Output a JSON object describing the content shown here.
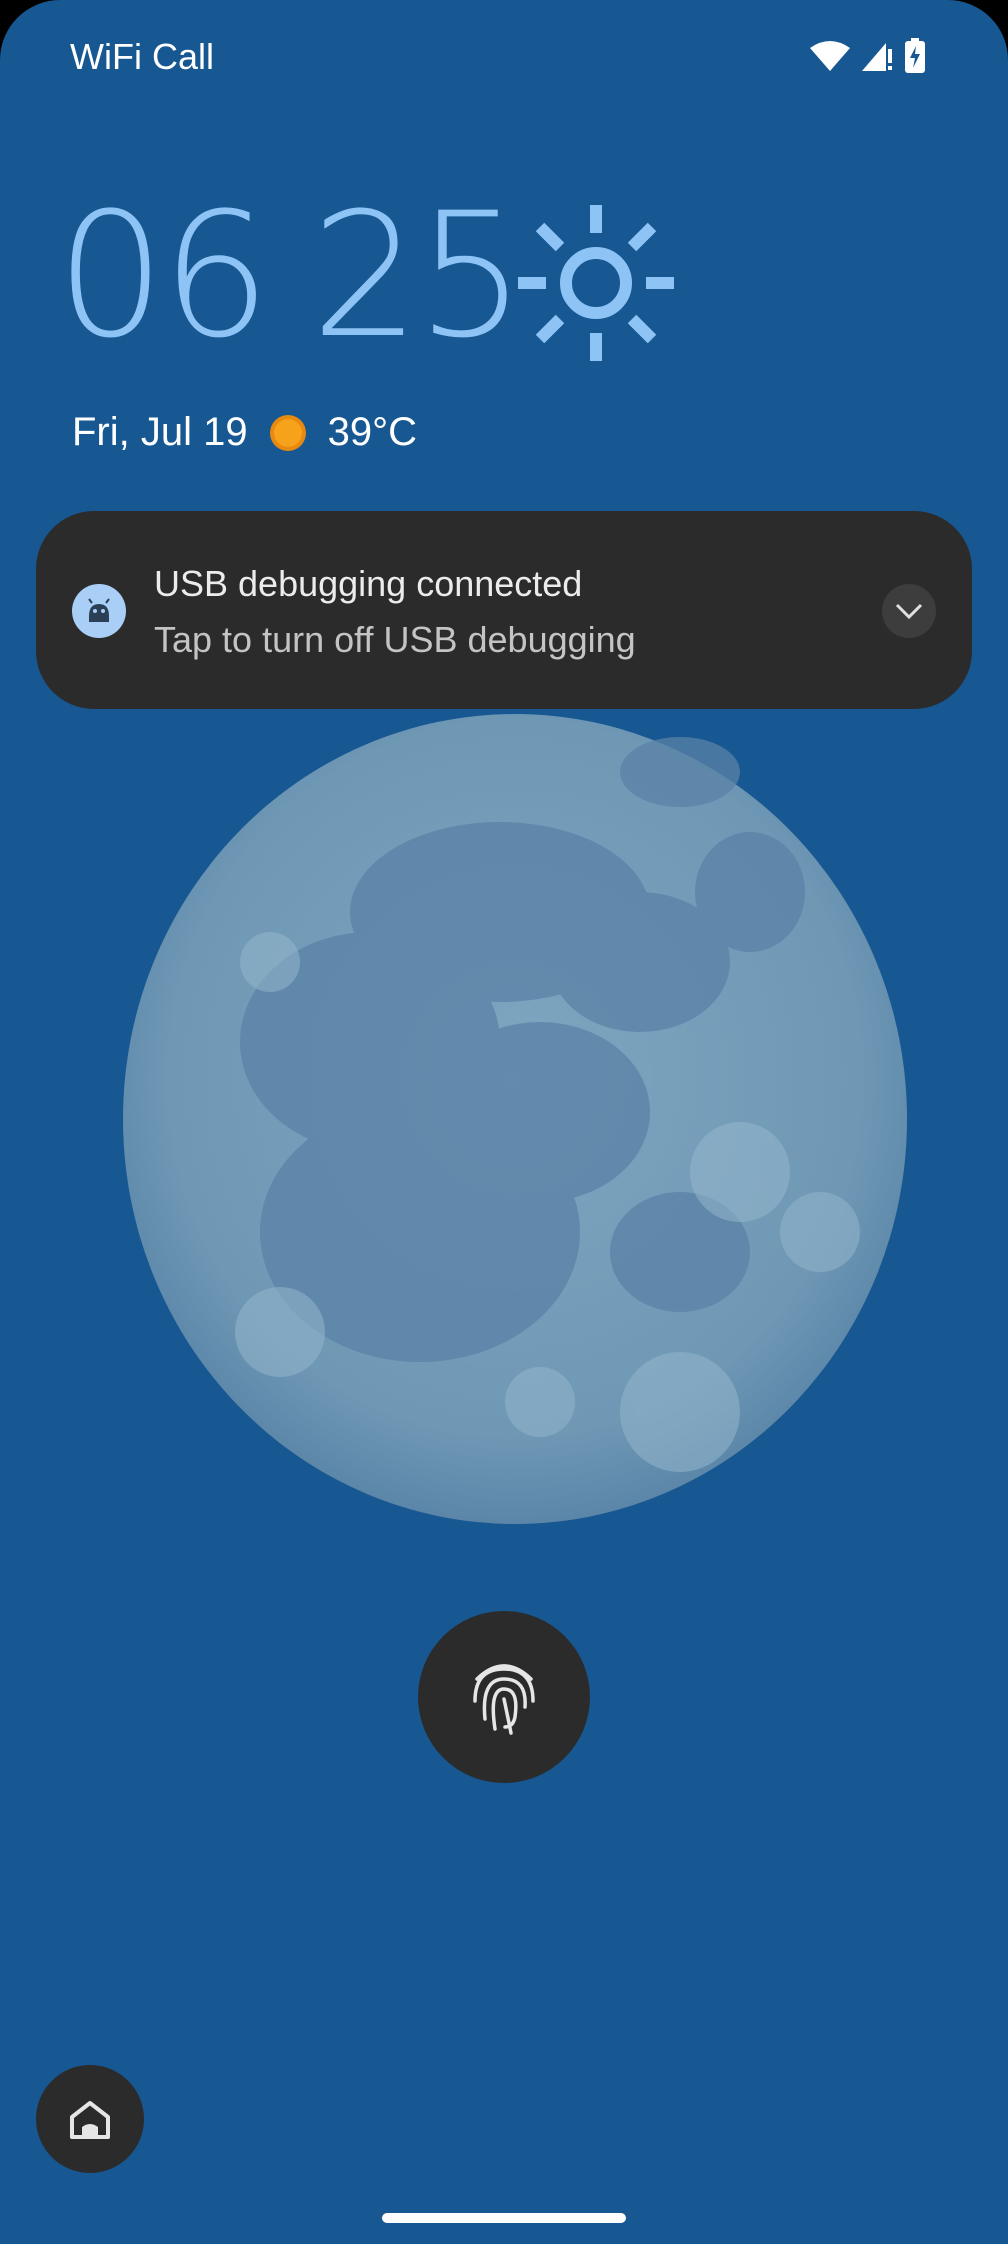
{
  "status_bar": {
    "carrier": "WiFi Call",
    "icons": [
      "wifi-icon",
      "signal-alert-icon",
      "battery-charging-icon"
    ]
  },
  "lock_screen": {
    "hour": "06",
    "minute": "25",
    "clock_weather_icon": "sun-icon",
    "date": "Fri, Jul 19",
    "weather_icon": "sunny-icon",
    "temperature": "39°C"
  },
  "notification": {
    "icon": "android-debug-icon",
    "title": "USB debugging connected",
    "text": "Tap to turn off USB debugging",
    "expand_icon": "chevron-down-icon"
  },
  "wallpaper": {
    "subject": "moon-image"
  },
  "controls": {
    "fingerprint_icon": "fingerprint-icon",
    "home_icon": "home-icon",
    "nav_handle": "navigation-handle"
  },
  "colors": {
    "background": "#175792",
    "clock": "#8ec3f6",
    "card": "#2b2b2b",
    "accent_sun": "#f7a21b"
  }
}
